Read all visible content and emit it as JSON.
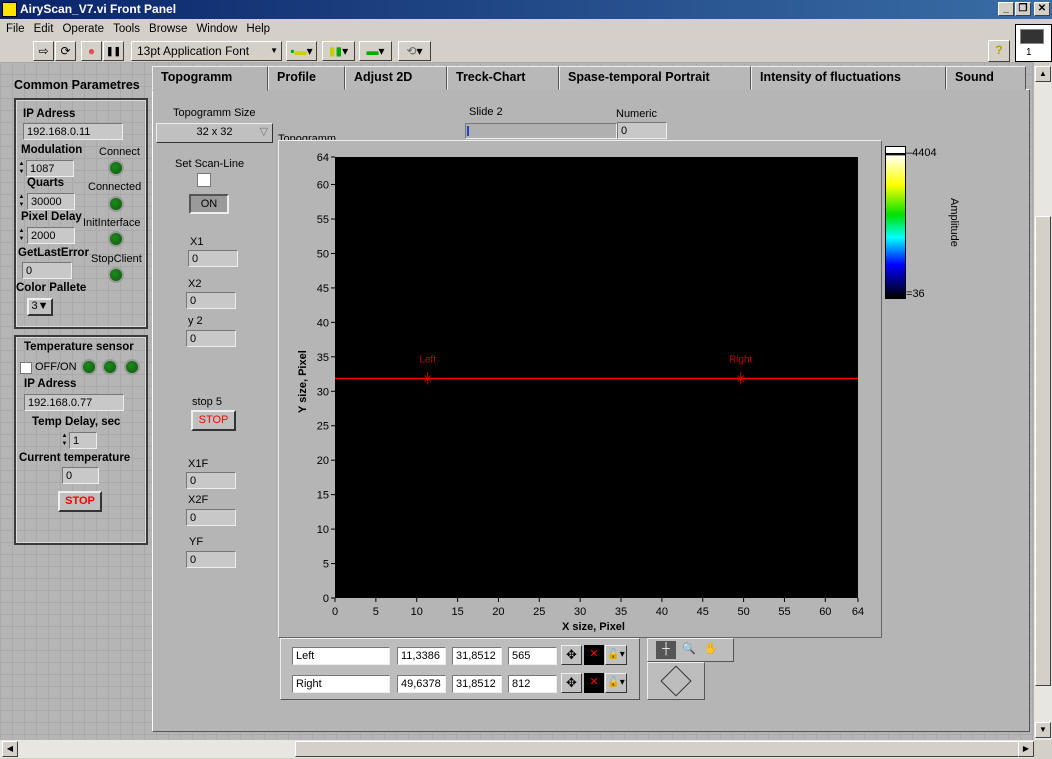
{
  "window": {
    "title": "AiryScan_V7.vi Front Panel",
    "min": "_",
    "restore": "❐",
    "close": "✕"
  },
  "menu": [
    "File",
    "Edit",
    "Operate",
    "Tools",
    "Browse",
    "Window",
    "Help"
  ],
  "toolbar": {
    "run": "⇨",
    "run_continuous": "⟳",
    "abort": "●",
    "pause": "❚❚",
    "font": "13pt Application Font",
    "font_arrow": "▼",
    "align": "▾",
    "distribute": "▾",
    "resize": "▾",
    "reorder": "▾",
    "help": "?",
    "icon_label": "1"
  },
  "left": {
    "title": "Common Parametres",
    "ip_label": "IP Adress",
    "ip": "192.168.0.11",
    "modulation_label": "Modulation",
    "modulation": "1087",
    "quarts_label": "Quarts",
    "quarts": "30000",
    "pixel_delay_label": "Pixel Delay",
    "pixel_delay": "2000",
    "error_label": "GetLastError",
    "error": "0",
    "pallete_label": "Color Pallete",
    "pallete": "3",
    "leds": [
      "Connect",
      "Connected",
      "InitInterface",
      "StopClient"
    ]
  },
  "temp": {
    "title": "Temperature sensor",
    "onoff": "OFF/ON",
    "ip_label": "IP Adress",
    "ip": "192.168.0.77",
    "delay_label": "Temp Delay, sec",
    "delay": "1",
    "current_label": "Current temperature",
    "current": "0",
    "stop": "STOP"
  },
  "tabs": [
    "Topogramm",
    "Profile",
    "Adjust 2D",
    "Treck-Chart",
    "Spase-temporal Portrait",
    "Intensity of fluctuations",
    "Sound"
  ],
  "topogramm": {
    "size_label": "Topogramm Size",
    "size": "32 x 32",
    "scanline_label": "Set Scan-Line",
    "on": "ON",
    "x1_label": "X1",
    "x1": "0",
    "x2_label": "X2",
    "x2": "0",
    "y2_label": "y 2",
    "y2": "0",
    "stop5_label": "stop 5",
    "stop5": "STOP",
    "x1f_label": "X1F",
    "x1f": "0",
    "x2f_label": "X2F",
    "x2f": "0",
    "yf_label": "YF",
    "yf": "0",
    "slide_label": "Slide 2",
    "slide_value": 0,
    "numeric_label": "Numeric",
    "numeric": "0",
    "graph_label": "Topogramm"
  },
  "graph": {
    "xlabel": "X size, Pixel",
    "ylabel": "Y size, Pixel",
    "xlim": [
      0,
      64
    ],
    "ylim": [
      0,
      64
    ],
    "xticks": [
      "0",
      "5",
      "10",
      "15",
      "20",
      "25",
      "30",
      "35",
      "40",
      "45",
      "50",
      "55",
      "60",
      "64"
    ],
    "yticks": [
      "0",
      "5",
      "10",
      "15",
      "20",
      "25",
      "30",
      "35",
      "40",
      "45",
      "50",
      "55",
      "60",
      "64"
    ],
    "colorbar": {
      "label": "Amplitude",
      "max": "4404",
      "min": "36"
    },
    "line_color": "#ff0000",
    "cursors": [
      {
        "name": "Left",
        "plot_label": "Left",
        "x": "11,3386",
        "y": "31,8512",
        "index": "565",
        "xv": 11.3386,
        "yv": 31.8512
      },
      {
        "name": "Right",
        "plot_label": "Right",
        "x": "49,6378",
        "y": "31,8512",
        "index": "812",
        "xv": 49.6378,
        "yv": 31.8512
      }
    ]
  }
}
